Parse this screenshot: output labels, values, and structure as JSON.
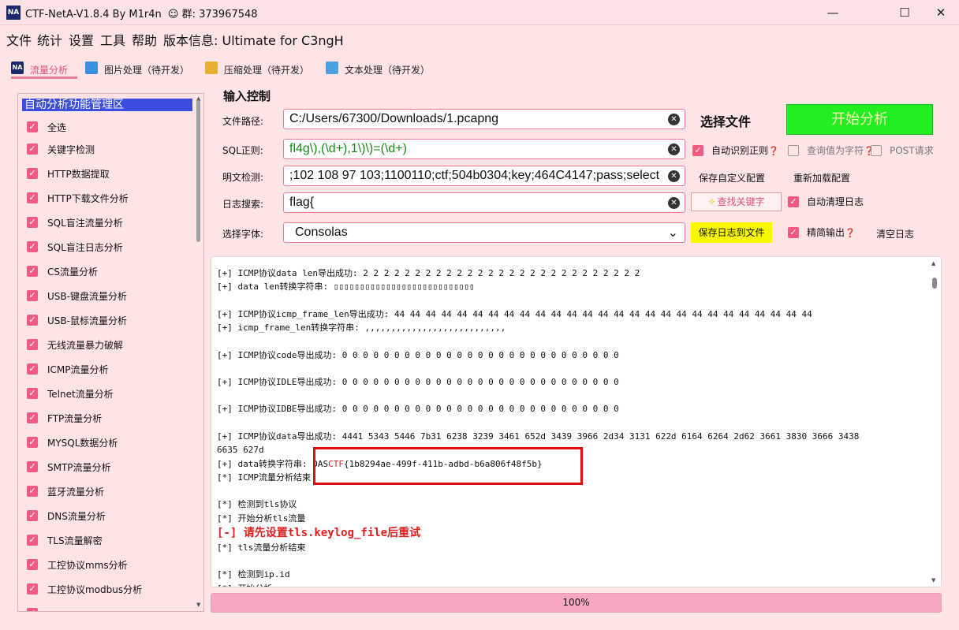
{
  "window": {
    "title": "CTF-NetA-V1.8.4 By M1r4n",
    "group_label": "群: 373967548",
    "logo_text": "NA"
  },
  "menu": {
    "items": [
      "文件",
      "统计",
      "设置",
      "工具",
      "帮助",
      "版本信息: Ultimate for C3ngH"
    ]
  },
  "tabs": [
    {
      "label": "流量分析",
      "active": true,
      "icon": "na-logo-icon"
    },
    {
      "label": "图片处理（待开发）",
      "active": false,
      "icon": "image-icon"
    },
    {
      "label": "压缩处理（待开发）",
      "active": false,
      "icon": "archive-icon"
    },
    {
      "label": "文本处理（待开发）",
      "active": false,
      "icon": "document-icon"
    }
  ],
  "left_panel": {
    "header": "自动分析功能管理区",
    "items": [
      {
        "label": "全选",
        "checked": true
      },
      {
        "label": "关键字检测",
        "checked": true
      },
      {
        "label": "HTTP数据提取",
        "checked": true
      },
      {
        "label": "HTTP下载文件分析",
        "checked": true
      },
      {
        "label": "SQL盲注流量分析",
        "checked": true
      },
      {
        "label": "SQL盲注日志分析",
        "checked": true
      },
      {
        "label": "CS流量分析",
        "checked": true
      },
      {
        "label": "USB-键盘流量分析",
        "checked": true
      },
      {
        "label": "USB-鼠标流量分析",
        "checked": true
      },
      {
        "label": "无线流量暴力破解",
        "checked": true
      },
      {
        "label": "ICMP流量分析",
        "checked": true
      },
      {
        "label": "Telnet流量分析",
        "checked": true
      },
      {
        "label": "FTP流量分析",
        "checked": true
      },
      {
        "label": "MYSQL数据分析",
        "checked": true
      },
      {
        "label": "SMTP流量分析",
        "checked": true
      },
      {
        "label": "蓝牙流量分析",
        "checked": true
      },
      {
        "label": "DNS流量分析",
        "checked": true
      },
      {
        "label": "TLS流量解密",
        "checked": true
      },
      {
        "label": "工控协议mms分析",
        "checked": true
      },
      {
        "label": "工控协议modbus分析",
        "checked": true
      }
    ]
  },
  "input_control": {
    "title": "输入控制",
    "file_path": {
      "label": "文件路径:",
      "value": "C:/Users/67300/Downloads/1.pcapng"
    },
    "sql_regex": {
      "label": "SQL正则:",
      "value": "fl4g\\),(\\d+),1\\)\\)=(\\d+)"
    },
    "plaintext": {
      "label": "明文检测:",
      "value": ";102 108 97 103;1100110;ctf;504b0304;key;464C4147;pass;select"
    },
    "log_search": {
      "label": "日志搜索:",
      "value": "flag{"
    },
    "font": {
      "label": "选择字体:",
      "value": "Consolas"
    },
    "select_file_button": "选择文件",
    "start_button": "开始分析",
    "auto_regex": {
      "label": "自动识别正则",
      "checked": true
    },
    "query_as_char": {
      "label": "查询值为字符",
      "checked": false
    },
    "post_request": {
      "label": "POST请求",
      "checked": false
    },
    "save_config": "保存自定义配置",
    "reload_config": "重新加载配置",
    "find_keyword": "查找关键字",
    "auto_clean_log": {
      "label": "自动清理日志",
      "checked": true
    },
    "save_log": "保存日志到文件",
    "concise_output": {
      "label": "精简输出",
      "checked": true
    },
    "clear_log": "清空日志"
  },
  "log": {
    "lines": [
      {
        "text": "[+] ICMP协议data len导出成功: 2 2 2 2 2 2 2 2 2 2 2 2 2 2 2 2 2 2 2 2 2 2 2 2 2 2 2",
        "type": "normal"
      },
      {
        "text": "[+] data len转换字符串: ▯▯▯▯▯▯▯▯▯▯▯▯▯▯▯▯▯▯▯▯▯▯▯▯▯▯▯",
        "type": "normal"
      },
      {
        "text": "",
        "type": "gap"
      },
      {
        "text": "[+] ICMP协议icmp_frame_len导出成功: 44 44 44 44 44 44 44 44 44 44 44 44 44 44 44 44 44 44 44 44 44 44 44 44 44 44 44",
        "type": "normal"
      },
      {
        "text": "[+] icmp_frame_len转换字符串: ,,,,,,,,,,,,,,,,,,,,,,,,,,,",
        "type": "normal"
      },
      {
        "text": "",
        "type": "gap"
      },
      {
        "text": "[+] ICMP协议code导出成功: 0 0 0 0 0 0 0 0 0 0 0 0 0 0 0 0 0 0 0 0 0 0 0 0 0 0 0",
        "type": "normal"
      },
      {
        "text": "",
        "type": "gap"
      },
      {
        "text": "[+] ICMP协议IDLE导出成功: 0 0 0 0 0 0 0 0 0 0 0 0 0 0 0 0 0 0 0 0 0 0 0 0 0 0 0",
        "type": "normal"
      },
      {
        "text": "",
        "type": "gap"
      },
      {
        "text": "[+] ICMP协议IDBE导出成功: 0 0 0 0 0 0 0 0 0 0 0 0 0 0 0 0 0 0 0 0 0 0 0 0 0 0 0",
        "type": "normal"
      },
      {
        "text": "",
        "type": "gap"
      },
      {
        "text": "[+] ICMP协议data导出成功: 4441 5343 5446 7b31 6238 3239 3461 652d 3439 3966 2d34 3131 622d 6164 6264 2d62 3661 3830 3666 3438",
        "type": "normal"
      },
      {
        "text": "6635 627d",
        "type": "normal"
      }
    ],
    "flag_line": {
      "prefix": "[+] data转换字符串: ",
      "flag_start": "DAS",
      "flag_ctf": "CTF",
      "flag_rest": "{1b8294ae-499f-411b-adbd-b6a806f48f5b}"
    },
    "lines_after": [
      {
        "text": "[*] ICMP流量分析结束",
        "type": "normal"
      },
      {
        "text": "",
        "type": "gap"
      },
      {
        "text": "[*] 检测到tls协议",
        "type": "normal"
      },
      {
        "text": "[*] 开始分析tls流量",
        "type": "normal"
      },
      {
        "text": "[-] 请先设置tls.keylog_file后重试",
        "type": "err"
      },
      {
        "text": "[*] tls流量分析结束",
        "type": "normal"
      },
      {
        "text": "",
        "type": "gap"
      },
      {
        "text": "[*] 检测到ip.id",
        "type": "normal"
      },
      {
        "text": "[*] 开始分析",
        "type": "normal"
      }
    ]
  },
  "progress": {
    "label": "100%",
    "value": 1.0
  },
  "colors": {
    "background": "#ffe4e6",
    "accent_pink": "#f25a82",
    "start_green": "#22ee22",
    "save_yellow": "#f8f800",
    "highlight_red": "#e01010",
    "header_blue": "#3c4de0"
  }
}
